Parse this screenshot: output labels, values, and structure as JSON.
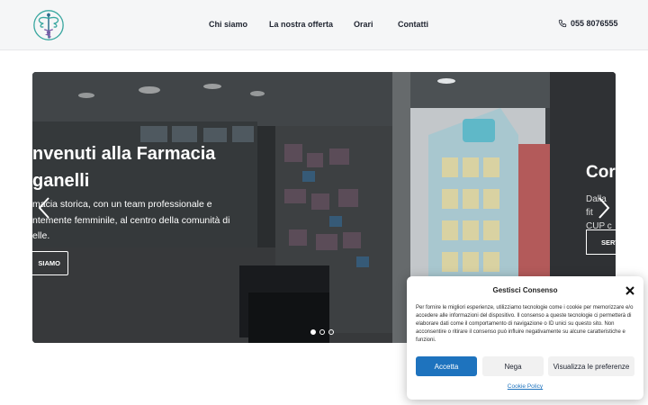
{
  "header": {
    "logo_icon": "caduceus-logo",
    "nav": [
      {
        "label": "Chi siamo"
      },
      {
        "label": "La nostra offerta"
      },
      {
        "label": "Orari"
      },
      {
        "label": "Contatti"
      }
    ],
    "phone": {
      "icon": "phone-icon",
      "number": "055 8076555"
    }
  },
  "slider": {
    "slide1": {
      "title": "nvenuti alla Farmacia\nganelli",
      "description": "macia storica, con un team professionale e\nntemente femminile, al centro della comunità di\nelle.",
      "button_label": "SIAMO"
    },
    "slide2": {
      "title": "Cor",
      "description": "Dalla fit\nCUP c",
      "button_label": "SERV"
    },
    "dots_total": 3,
    "active_dot": 1
  },
  "cookie": {
    "title": "Gestisci Consenso",
    "text": "Per fornire le migliori esperienze, utilizziamo tecnologie come i cookie per memorizzare e/o accedere alle informazioni del dispositivo. Il consenso a queste tecnologie ci permetterà di elaborare dati come il comportamento di navigazione o ID unici su questo sito. Non acconsentire o ritirare il consenso può influire negativamente su alcune caratteristiche e funzioni.",
    "accept_label": "Accetta",
    "deny_label": "Nega",
    "prefs_label": "Visualizza le preferenze",
    "policy_label": "Cookie Policy"
  },
  "colors": {
    "accent": "#1e73be",
    "header_bg": "#f5f6f7",
    "logo_teal": "#3aa7a0",
    "logo_purple": "#7a5aa8"
  }
}
